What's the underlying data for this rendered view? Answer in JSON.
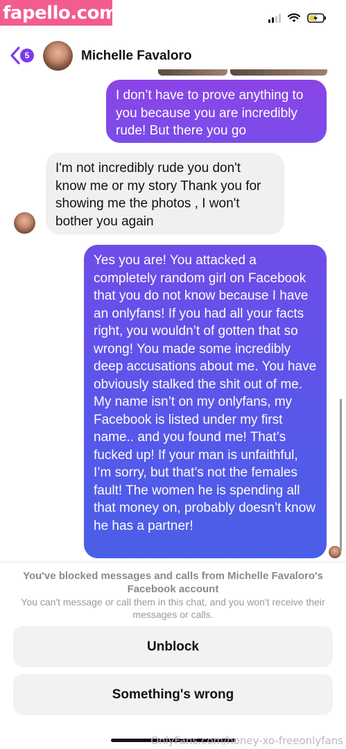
{
  "watermark_top": "fapello.com",
  "watermark_bottom": "OnlyFans.com/honey-xo-freeonlyfans",
  "header": {
    "back_badge": "5",
    "contact_name": "Michelle Favaloro"
  },
  "messages": [
    {
      "direction": "out",
      "text": "I don’t have to prove anything to you because you are incredibly rude! But there you go"
    },
    {
      "direction": "in",
      "text": "I'm not incredibly rude you don't know me or my story Thank you for showing me the photos , I won't bother you again"
    },
    {
      "direction": "out",
      "text": "Yes you are! You attacked a completely random girl on Facebook that you do not know because I have an onlyfans! If you had all your facts right, you wouldn’t of gotten that so wrong! You made some incredibly deep accusations about me. You have obviously stalked the shit out of me. My name isn’t on my onlyfans, my Facebook is listed under my first name.. and you found me! That’s fucked up! If your man is unfaithful, I’m sorry, but that’s not the females fault! The women he is spending all that money on, probably doesn’t know he has a partner!"
    }
  ],
  "blocked": {
    "title": "You've blocked messages and calls from Michelle Favaloro's Facebook account",
    "subtitle": "You can't message or call them in this chat, and you won't receive their messages or calls.",
    "unblock_label": "Unblock",
    "wrong_label": "Something's wrong"
  },
  "colors": {
    "accent": "#7c3aed",
    "outgoing_start": "#8b44e6",
    "outgoing_end": "#4a5fe8",
    "incoming_bg": "#f0f0f0",
    "watermark": "#f25d8e"
  }
}
